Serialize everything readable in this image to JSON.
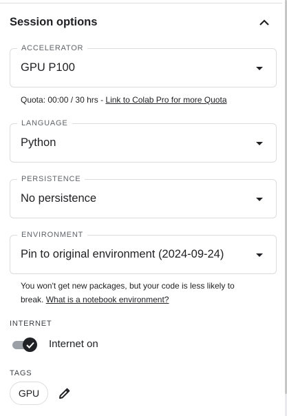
{
  "header": {
    "title": "Session options"
  },
  "accelerator": {
    "legend": "ACCELERATOR",
    "value": "GPU P100",
    "quota_text": "Quota: 00:00 / 30 hrs - ",
    "quota_link": "Link to Colab Pro for more Quota"
  },
  "language": {
    "legend": "LANGUAGE",
    "value": "Python"
  },
  "persistence": {
    "legend": "PERSISTENCE",
    "value": "No persistence"
  },
  "environment": {
    "legend": "ENVIRONMENT",
    "value": "Pin to original environment (2024-09-24)",
    "helper_line1": "You won't get new packages, but your code is less likely to",
    "helper_line2": "break. ",
    "helper_link": "What is a notebook environment?"
  },
  "internet": {
    "label": "INTERNET",
    "toggle_label": "Internet on",
    "enabled": true
  },
  "tags": {
    "label": "TAGS",
    "items": [
      "GPU"
    ]
  },
  "icons": {
    "collapse": "chevron-up-icon",
    "edit": "pencil-icon",
    "check": "check-icon",
    "dropdown": "caret-down-icon"
  }
}
